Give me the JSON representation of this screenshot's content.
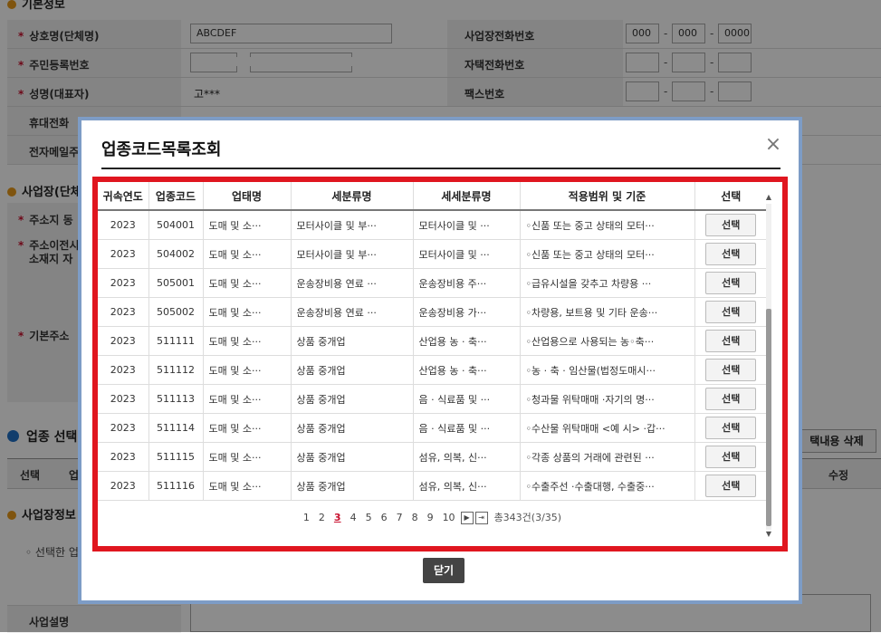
{
  "background": {
    "section_basic": "기본정보",
    "rows": [
      {
        "label": "상호명(단체명)",
        "required": true,
        "value": "ABCDEF",
        "right_label": "사업장전화번호",
        "phone": [
          "000",
          "000",
          "0000"
        ]
      },
      {
        "label": "주민등록번호",
        "required": true,
        "right_label": "자택전화번호",
        "phone": [
          "",
          "",
          ""
        ]
      },
      {
        "label": "성명(대표자)",
        "required": true,
        "value": "고***",
        "right_label": "팩스번호",
        "phone": [
          "",
          "",
          ""
        ]
      },
      {
        "label": "휴대전화",
        "required": false
      },
      {
        "label": "전자메일주",
        "required": false
      }
    ],
    "section_business": "사업장(단체",
    "addr_label1": "주소지 동",
    "addr_label2a": "주소이전시",
    "addr_label2b": "소재지 자",
    "base_addr": "기본주소",
    "section_industry": "업종 선택",
    "industry_col1": "선택",
    "industry_col2": "업",
    "industry_col_edit": "수정",
    "delete_btn": "택내용 삭제",
    "section_biz_info": "사업장정보",
    "selected_text": "선택한 업",
    "biz_desc": "사업설명",
    "dash": "-",
    "star": "*",
    "bullet": "◦"
  },
  "modal": {
    "title": "업종코드목록조회",
    "close_icon": "×",
    "headers": [
      "귀속연도",
      "업종코드",
      "업태명",
      "세분류명",
      "세세분류명",
      "적용범위 및 기준",
      "선택"
    ],
    "rows": [
      {
        "year": "2023",
        "code": "504001",
        "type": "도매 및 소···",
        "sub": "모터사이클 및 부···",
        "subsub": "모터사이클 및 ···",
        "scope": "◦신품 또는 중고 상태의 모터···",
        "btn": "선택"
      },
      {
        "year": "2023",
        "code": "504002",
        "type": "도매 및 소···",
        "sub": "모터사이클 및 부···",
        "subsub": "모터사이클 및 ···",
        "scope": "◦신품 또는 중고 상태의 모터···",
        "btn": "선택"
      },
      {
        "year": "2023",
        "code": "505001",
        "type": "도매 및 소···",
        "sub": "운송장비용 연료 ···",
        "subsub": "운송장비용 주···",
        "scope": "◦급유시설을 갖추고 차량용 ···",
        "btn": "선택"
      },
      {
        "year": "2023",
        "code": "505002",
        "type": "도매 및 소···",
        "sub": "운송장비용 연료 ···",
        "subsub": "운송장비용 가···",
        "scope": "◦차량용, 보트용 및 기타 운송···",
        "btn": "선택"
      },
      {
        "year": "2023",
        "code": "511111",
        "type": "도매 및 소···",
        "sub": "상품 중개업",
        "subsub": "산업용 농 · 축···",
        "scope": "◦산업용으로 사용되는 농◦축···",
        "btn": "선택"
      },
      {
        "year": "2023",
        "code": "511112",
        "type": "도매 및 소···",
        "sub": "상품 중개업",
        "subsub": "산업용 농 · 축···",
        "scope": "◦농 · 축 · 임산물(법정도매시···",
        "btn": "선택"
      },
      {
        "year": "2023",
        "code": "511113",
        "type": "도매 및 소···",
        "sub": "상품 중개업",
        "subsub": "음 · 식료품 및 ···",
        "scope": "◦청과물 위탁매매 ·자기의 명···",
        "btn": "선택"
      },
      {
        "year": "2023",
        "code": "511114",
        "type": "도매 및 소···",
        "sub": "상품 중개업",
        "subsub": "음 · 식료품 및 ···",
        "scope": "◦수산물 위탁매매 <예 시> ·갑···",
        "btn": "선택"
      },
      {
        "year": "2023",
        "code": "511115",
        "type": "도매 및 소···",
        "sub": "상품 중개업",
        "subsub": "섬유, 의복, 신···",
        "scope": "◦각종 상품의 거래에 관련된 ···",
        "btn": "선택"
      },
      {
        "year": "2023",
        "code": "511116",
        "type": "도매 및 소···",
        "sub": "상품 중개업",
        "subsub": "섬유, 의복, 신···",
        "scope": "◦수출주선 ·수출대행, 수출중···",
        "btn": "선택"
      }
    ],
    "pages": [
      "1",
      "2",
      "3",
      "4",
      "5",
      "6",
      "7",
      "8",
      "9",
      "10"
    ],
    "current_page": "3",
    "next_icon": "▶",
    "last_icon": "⇥",
    "total_text": "총343건(3/35)",
    "close_button": "닫기",
    "scroll_up": "▲",
    "scroll_down": "▼"
  }
}
